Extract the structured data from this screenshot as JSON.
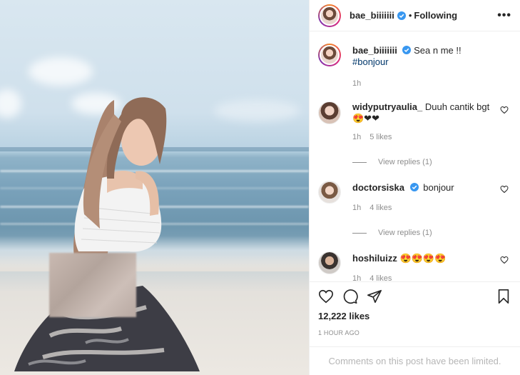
{
  "post": {
    "author": "bae_biiiiiii",
    "follow_status": "Following",
    "separator": "•",
    "more_label": "•••"
  },
  "caption": {
    "username": "bae_biiiiiii",
    "text": "Sea n me !!",
    "hashtag": "#bonjour",
    "time": "1h"
  },
  "comments": [
    {
      "username": "widyputryaulia_",
      "text": "Duuh cantik bgt",
      "emojis": "😍❤❤",
      "time": "1h",
      "likes": "5 likes",
      "view_replies": "View replies (1)",
      "verified": false
    },
    {
      "username": "doctorsiska",
      "text": "bonjour",
      "emojis": "",
      "time": "1h",
      "likes": "4 likes",
      "view_replies": "View replies (1)",
      "verified": true
    },
    {
      "username": "hoshiluizz",
      "text": "",
      "emojis": "😍😍😍😍",
      "time": "1h",
      "likes": "4 likes",
      "verified": false
    }
  ],
  "stats": {
    "likes": "12,222 likes",
    "posted": "1 HOUR AGO"
  },
  "footer": {
    "limited_text": "Comments on this post have been limited."
  },
  "colors": {
    "verified_blue": "#3897f0",
    "link_blue": "#00376b",
    "muted_gray": "#8e8e8e",
    "border": "#efefef"
  },
  "icons": [
    "verified-icon",
    "more-icon",
    "heart-icon",
    "comment-icon",
    "share-icon",
    "bookmark-icon"
  ]
}
